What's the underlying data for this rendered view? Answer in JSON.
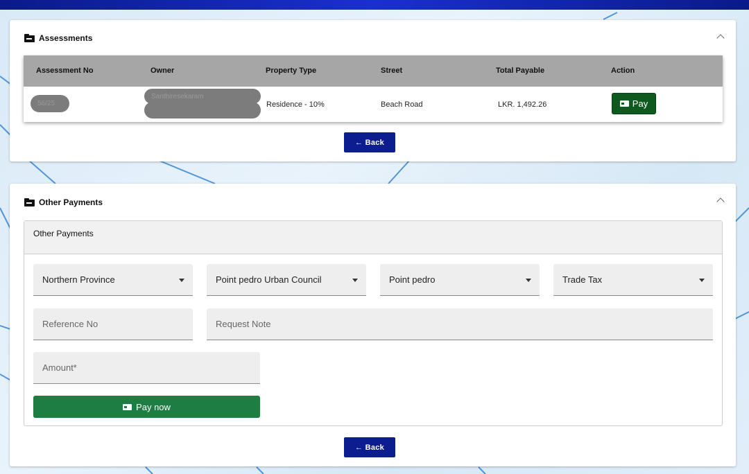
{
  "assessments": {
    "title": "Assessments",
    "columns": [
      "Assessment No",
      "Owner",
      "Property Type",
      "Street",
      "Total Payable",
      "Action"
    ],
    "rows": [
      {
        "assessment_no": "56/25",
        "owner": "Santhiresekaram",
        "property_type": "Residence - 10%",
        "street": "Beach Road",
        "total_payable": "LKR. 1,492.26",
        "action_label": "Pay"
      }
    ],
    "back_label": "← Back"
  },
  "other_payments": {
    "title": "Other Payments",
    "panel_title": "Other Payments",
    "province": "Northern Province",
    "council": "Point pedro Urban Council",
    "area": "Point pedro",
    "tax_type": "Trade Tax",
    "reference_placeholder": "Reference No",
    "note_placeholder": "Request Note",
    "amount_placeholder": "Amount*",
    "pay_now_label": "Pay now",
    "back_label": "← Back"
  },
  "colors": {
    "topbar": "#1a2fd0",
    "back_button": "#0b1d8f",
    "pay_button": "#0e5a1e",
    "pay_now_button": "#1e7d41",
    "table_header": "#a6a6a6"
  }
}
